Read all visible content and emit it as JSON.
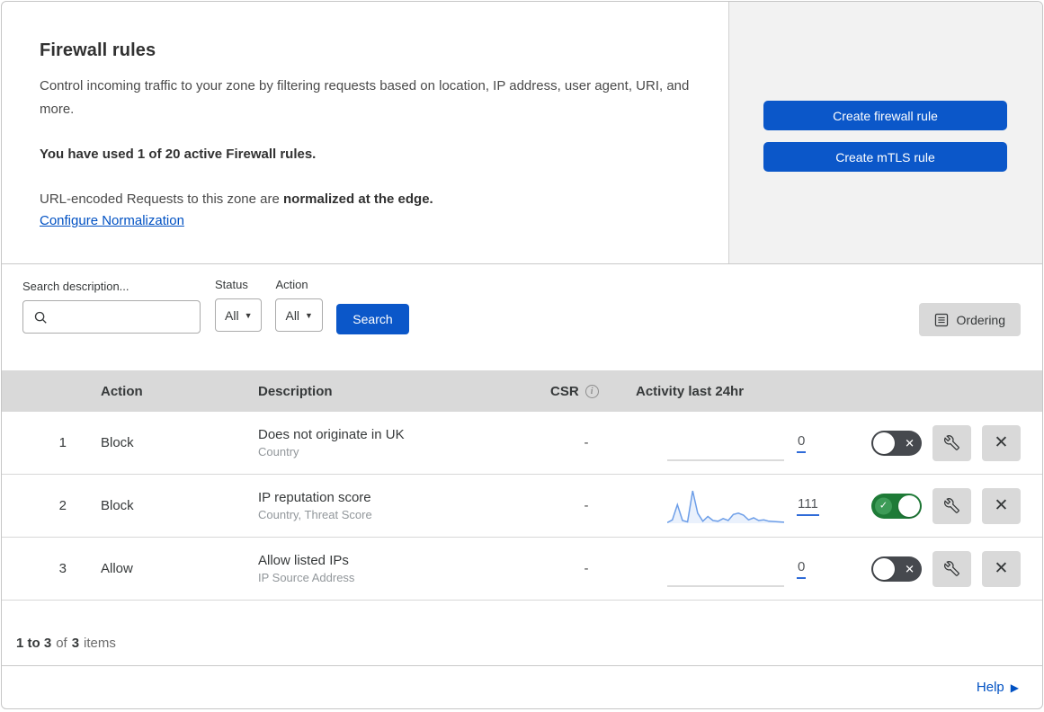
{
  "colors": {
    "primary_blue": "#0b57c9",
    "link_blue": "#0051c3",
    "toggle_on_green": "#1e7b37",
    "toggle_off_gray": "#46494e",
    "spark_line": "#6d9ee8",
    "spark_fill": "rgba(109,158,232,0.14)",
    "spark_flat": "#cfcfcf",
    "table_header_bg": "#d9d9d9",
    "panel_bg": "#f2f2f2"
  },
  "icons": {
    "dropdown_arrow": "▼",
    "toggle_off_cross": "✕",
    "toggle_on_check": "✓",
    "delete_cross": "✕",
    "help_arrow": "▶",
    "info": "i"
  },
  "header": {
    "title": "Firewall rules",
    "description": "Control incoming traffic to your zone by filtering requests based on location, IP address, user agent, URI, and more.",
    "usage": "You have used 1 of 20 active Firewall rules.",
    "normalization_prefix": "URL-encoded Requests to this zone are ",
    "normalization_bold": "normalized at the edge.",
    "normalization_link": "Configure Normalization",
    "create_firewall_button": "Create firewall rule",
    "create_mtls_button": "Create mTLS rule"
  },
  "filters": {
    "search_label": "Search description...",
    "search_value": "",
    "status_label": "Status",
    "status_value": "All",
    "action_label": "Action",
    "action_value": "All",
    "search_button": "Search",
    "ordering_button": "Ordering"
  },
  "table": {
    "headers": {
      "action": "Action",
      "description": "Description",
      "csr": "CSR",
      "activity": "Activity last 24hr"
    },
    "rows": [
      {
        "index": "1",
        "action": "Block",
        "description": "Does not originate in UK",
        "fields": "Country",
        "csr": "-",
        "count": "0",
        "enabled": false,
        "sparkline": [
          0,
          0,
          0,
          0,
          0,
          0,
          0,
          0,
          0,
          0,
          0,
          0
        ]
      },
      {
        "index": "2",
        "action": "Block",
        "description": "IP reputation score",
        "fields": "Country, Threat Score",
        "csr": "-",
        "count": "111",
        "enabled": true,
        "sparkline": [
          2,
          10,
          55,
          8,
          4,
          96,
          30,
          6,
          20,
          8,
          6,
          14,
          8,
          26,
          30,
          24,
          10,
          16,
          8,
          10,
          6,
          5,
          4,
          3
        ]
      },
      {
        "index": "3",
        "action": "Allow",
        "description": "Allow listed IPs",
        "fields": "IP Source Address",
        "csr": "-",
        "count": "0",
        "enabled": false,
        "sparkline": [
          0,
          0,
          0,
          0,
          0,
          0,
          0,
          0,
          0,
          0,
          0,
          0
        ]
      }
    ]
  },
  "footer": {
    "range_bold": "1 to 3",
    "of_text": "of",
    "total_bold": "3",
    "items_text": "items",
    "help_label": "Help"
  }
}
